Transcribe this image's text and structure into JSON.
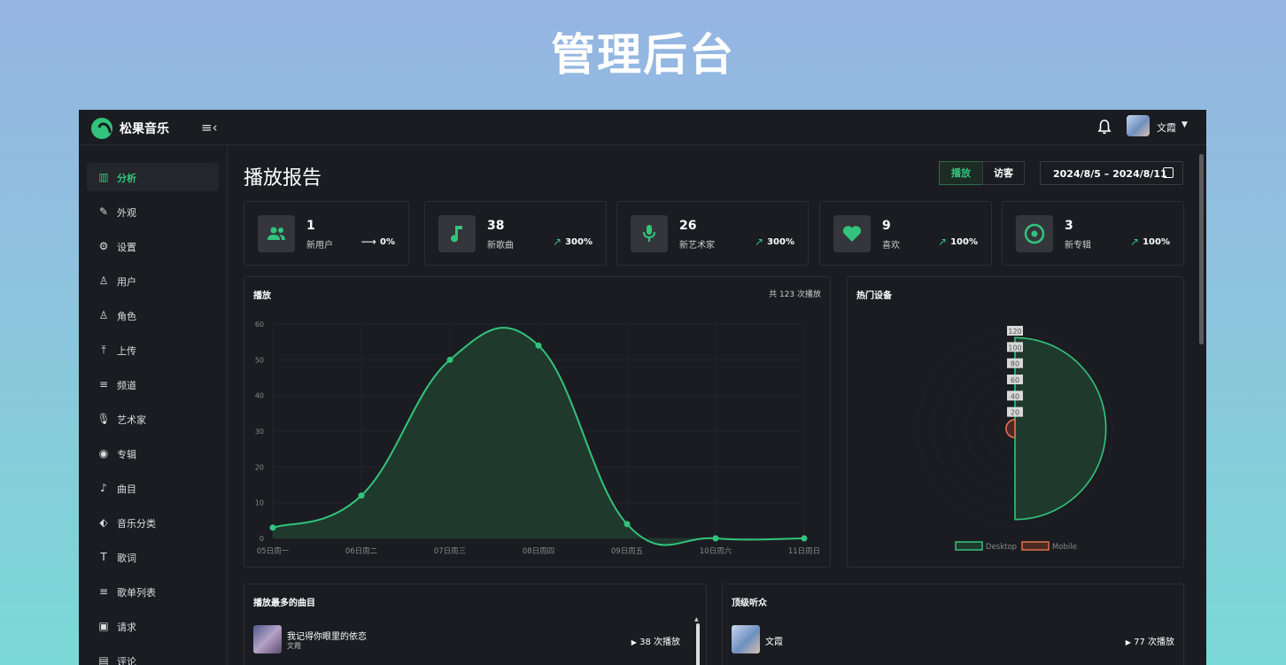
{
  "hero_title": "管理后台",
  "app": {
    "brand": "松果音乐",
    "user_name": "文霞"
  },
  "sidebar": {
    "items": [
      {
        "label": "分析",
        "icon": "chart-icon",
        "active": true
      },
      {
        "label": "外观",
        "icon": "brush-icon"
      },
      {
        "label": "设置",
        "icon": "gear-icon"
      },
      {
        "label": "用户",
        "icon": "user-icon"
      },
      {
        "label": "角色",
        "icon": "users-icon"
      },
      {
        "label": "上传",
        "icon": "upload-icon"
      },
      {
        "label": "频道",
        "icon": "playlist-icon"
      },
      {
        "label": "艺术家",
        "icon": "microphone-icon"
      },
      {
        "label": "专辑",
        "icon": "album-icon"
      },
      {
        "label": "曲目",
        "icon": "music-note-icon"
      },
      {
        "label": "音乐分类",
        "icon": "tag-icon"
      },
      {
        "label": "歌词",
        "icon": "text-icon"
      },
      {
        "label": "歌单列表",
        "icon": "playlist-add-icon"
      },
      {
        "label": "请求",
        "icon": "request-icon"
      },
      {
        "label": "评论",
        "icon": "comment-icon"
      }
    ]
  },
  "header": {
    "page_title": "播放报告",
    "toggle": {
      "play": "播放",
      "visitors": "访客"
    },
    "date_range": "2024/8/5 – 2024/8/11"
  },
  "stats": [
    {
      "value": "1",
      "label": "新用户",
      "trend": "0%",
      "trend_type": "flat",
      "icon": "users-icon"
    },
    {
      "value": "38",
      "label": "新歌曲",
      "trend": "300%",
      "trend_type": "up",
      "icon": "music-note-icon"
    },
    {
      "value": "26",
      "label": "新艺术家",
      "trend": "300%",
      "trend_type": "up",
      "icon": "microphone-icon"
    },
    {
      "value": "9",
      "label": "喜欢",
      "trend": "100%",
      "trend_type": "up",
      "icon": "heart-icon"
    },
    {
      "value": "3",
      "label": "新专辑",
      "trend": "100%",
      "trend_type": "up",
      "icon": "album-icon"
    }
  ],
  "play_card": {
    "title": "播放",
    "total": "共 123 次播放"
  },
  "device_card": {
    "title": "热门设备"
  },
  "top_tracks": {
    "title": "播放最多的曲目",
    "rows": [
      {
        "name": "我记得你眼里的依恋",
        "artist": "文霞",
        "plays": "38 次播放"
      }
    ]
  },
  "top_listeners": {
    "title": "顶级听众",
    "rows": [
      {
        "name": "文霞",
        "plays": "77 次播放"
      }
    ]
  },
  "colors": {
    "accent": "#32c47c",
    "mobile": "#e0704c",
    "bg": "#1b1c21"
  },
  "chart_data": [
    {
      "type": "area",
      "categories": [
        "05日周一",
        "06日周二",
        "07日周三",
        "08日周四",
        "09日周五",
        "10日周六",
        "11日周日"
      ],
      "series": [
        {
          "values": [
            3,
            12,
            50,
            54,
            4,
            0,
            0
          ]
        }
      ],
      "ylim": [
        0,
        60
      ],
      "yticks": [
        0,
        10,
        20,
        30,
        40,
        50,
        60
      ],
      "grid": true
    },
    {
      "type": "polar-area",
      "series": [
        {
          "name": "Desktop",
          "value": 112
        },
        {
          "name": "Mobile",
          "value": 11
        }
      ],
      "rticks": [
        20,
        40,
        60,
        80,
        100,
        120
      ],
      "rmax": 120,
      "legend": "bottom"
    }
  ]
}
